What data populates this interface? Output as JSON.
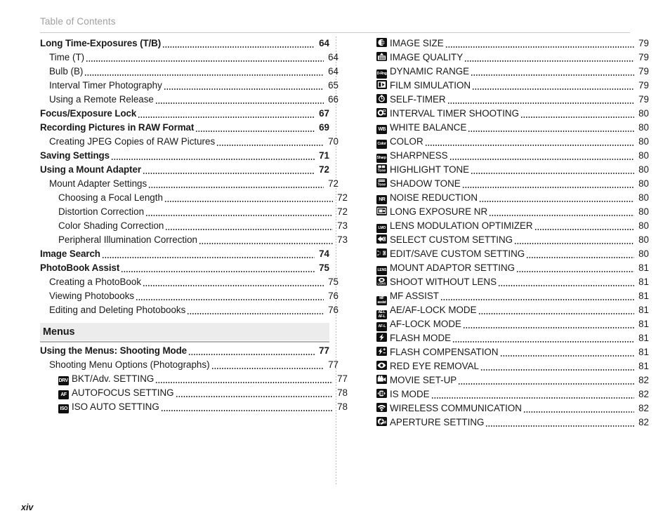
{
  "header": {
    "title": "Table of Contents"
  },
  "footer": {
    "page_label": "xiv"
  },
  "colors": {
    "band_bg": "#ececec",
    "header_text": "#a0a0a0",
    "rule": "#c9c9c9",
    "badge_bg": "#101010",
    "text": "#1a1a1a"
  },
  "left_column": {
    "entries": [
      {
        "level": 0,
        "title": "Long Time-Exposures (T/B)",
        "page": "64"
      },
      {
        "level": 1,
        "title": "Time (T)",
        "page": "64"
      },
      {
        "level": 1,
        "title": "Bulb (B)",
        "page": "64"
      },
      {
        "level": 1,
        "title": "Interval Timer Photography",
        "page": "65"
      },
      {
        "level": 1,
        "title": "Using a Remote Release",
        "page": "66"
      },
      {
        "level": 0,
        "title": "Focus/Exposure Lock",
        "page": "67"
      },
      {
        "level": 0,
        "title": "Recording Pictures in RAW Format",
        "page": "69"
      },
      {
        "level": 1,
        "title": "Creating JPEG Copies of RAW Pictures",
        "page": "70"
      },
      {
        "level": 0,
        "title": "Saving Settings",
        "page": "71"
      },
      {
        "level": 0,
        "title": "Using a Mount Adapter",
        "page": "72"
      },
      {
        "level": 1,
        "title": "Mount Adapter Settings",
        "page": "72"
      },
      {
        "level": 2,
        "title": "Choosing a Focal Length",
        "page": "72"
      },
      {
        "level": 2,
        "title": "Distortion Correction",
        "page": "72"
      },
      {
        "level": 2,
        "title": "Color Shading Correction",
        "page": "73"
      },
      {
        "level": 2,
        "title": "Peripheral Illumination Correction",
        "page": "73"
      },
      {
        "level": 0,
        "title": "Image Search",
        "page": "74"
      },
      {
        "level": 0,
        "title": "PhotoBook Assist",
        "page": "75"
      },
      {
        "level": 1,
        "title": "Creating a PhotoBook",
        "page": "75"
      },
      {
        "level": 1,
        "title": "Viewing Photobooks",
        "page": "76"
      },
      {
        "level": 1,
        "title": "Editing and Deleting Photobooks",
        "page": "76"
      },
      {
        "section": "Menus"
      },
      {
        "level": 0,
        "title": "Using the Menus: Shooting Mode",
        "page": "77"
      },
      {
        "level": 1,
        "title": "Shooting Menu Options (Photographs)",
        "page": "77"
      },
      {
        "level": 2,
        "icon": "drive-mode-icon",
        "icon_text": "DRV",
        "icon_style": "text",
        "title": "BKT/Adv. SETTING",
        "page": "77"
      },
      {
        "level": 2,
        "icon": "autofocus-icon",
        "icon_text": "AF",
        "icon_style": "text",
        "title": "AUTOFOCUS SETTING",
        "page": "78"
      },
      {
        "level": 2,
        "icon": "iso-icon",
        "icon_text": "ISO",
        "icon_style": "text",
        "title": "ISO AUTO SETTING",
        "page": "78"
      }
    ]
  },
  "right_column": {
    "entries": [
      {
        "level": 2,
        "icon": "image-size-icon",
        "icon_style": "shape",
        "shape": "image-size",
        "title": "IMAGE SIZE",
        "page": "79"
      },
      {
        "level": 2,
        "icon": "image-quality-icon",
        "icon_style": "shape",
        "shape": "image-quality",
        "title": "IMAGE QUALITY",
        "page": "79"
      },
      {
        "level": 2,
        "icon": "dynamic-range-icon",
        "icon_text": "D-Rng",
        "icon_style": "text-tiny",
        "title": "DYNAMIC RANGE",
        "page": "79"
      },
      {
        "level": 2,
        "icon": "film-simulation-icon",
        "icon_style": "shape",
        "shape": "film",
        "title": "FILM SIMULATION",
        "page": "79"
      },
      {
        "level": 2,
        "icon": "self-timer-icon",
        "icon_style": "shape",
        "shape": "timer",
        "title": "SELF-TIMER",
        "page": "79"
      },
      {
        "level": 2,
        "icon": "interval-timer-icon",
        "icon_style": "shape",
        "shape": "interval",
        "title": "INTERVAL TIMER SHOOTING",
        "page": "80"
      },
      {
        "level": 2,
        "icon": "white-balance-icon",
        "icon_text": "WB",
        "icon_style": "text",
        "title": "WHITE BALANCE",
        "page": "80"
      },
      {
        "level": 2,
        "icon": "color-icon",
        "icon_text": "Color",
        "icon_style": "text-tiny",
        "title": "COLOR",
        "page": "80"
      },
      {
        "level": 2,
        "icon": "sharpness-icon",
        "icon_text": "Sharp",
        "icon_style": "text-tiny",
        "title": "SHARPNESS",
        "page": "80"
      },
      {
        "level": 2,
        "icon": "highlight-tone-icon",
        "icon_text": "Tone",
        "icon_style": "tone-high",
        "title": "HIGHLIGHT TONE",
        "page": "80"
      },
      {
        "level": 2,
        "icon": "shadow-tone-icon",
        "icon_text": "Tone",
        "icon_style": "tone-low",
        "title": "SHADOW TONE",
        "page": "80"
      },
      {
        "level": 2,
        "icon": "noise-reduction-icon",
        "icon_text": "NR",
        "icon_style": "text",
        "title": "NOISE REDUCTION",
        "page": "80"
      },
      {
        "level": 2,
        "icon": "long-exposure-nr-icon",
        "icon_style": "shape",
        "shape": "longexp",
        "title": "LONG EXPOSURE NR",
        "page": "80"
      },
      {
        "level": 2,
        "icon": "lens-modulation-optimizer-icon",
        "icon_text": "LMO",
        "icon_style": "text-tiny",
        "title": "LENS MODULATION OPTIMIZER",
        "page": "80"
      },
      {
        "level": 2,
        "icon": "select-custom-setting-icon",
        "icon_style": "shape",
        "shape": "arrow-left-c",
        "title": "SELECT CUSTOM SETTING",
        "page": "80"
      },
      {
        "level": 2,
        "icon": "edit-save-custom-setting-icon",
        "icon_style": "shape",
        "shape": "arrow-right-c",
        "title": "EDIT/SAVE CUSTOM SETTING",
        "page": "80"
      },
      {
        "level": 2,
        "icon": "mount-adaptor-icon",
        "icon_text": "LENS",
        "icon_style": "text-tiny",
        "title": "MOUNT ADAPTOR SETTING",
        "page": "81"
      },
      {
        "level": 2,
        "icon": "shoot-without-lens-icon",
        "icon_style": "shape",
        "shape": "nolens",
        "title": "SHOOT WITHOUT LENS",
        "page": "81"
      },
      {
        "level": 2,
        "icon": "mf-assist-icon",
        "icon_text": "MF",
        "icon_style": "two-line",
        "icon_text2": "assist",
        "title": "MF ASSIST",
        "page": "81"
      },
      {
        "level": 2,
        "icon": "ae-af-lock-mode-icon",
        "icon_text": "AE-L",
        "icon_style": "two-line",
        "icon_text2": "AF-L",
        "title": "AE/AF-LOCK MODE",
        "page": "81"
      },
      {
        "level": 2,
        "icon": "af-lock-mode-icon",
        "icon_text": "AF-L",
        "icon_style": "text-tiny",
        "title": "AF-LOCK MODE",
        "page": "81"
      },
      {
        "level": 2,
        "icon": "flash-mode-icon",
        "icon_style": "shape",
        "shape": "flash",
        "title": "FLASH MODE",
        "page": "81"
      },
      {
        "level": 2,
        "icon": "flash-compensation-icon",
        "icon_style": "shape",
        "shape": "flash-pm",
        "title": "FLASH COMPENSATION",
        "page": "81"
      },
      {
        "level": 2,
        "icon": "red-eye-removal-icon",
        "icon_style": "shape",
        "shape": "eye",
        "title": "RED EYE REMOVAL",
        "page": "81"
      },
      {
        "level": 2,
        "icon": "movie-set-up-icon",
        "icon_style": "shape",
        "shape": "movie",
        "title": "MOVIE SET-UP",
        "page": "82"
      },
      {
        "level": 2,
        "icon": "is-mode-icon",
        "icon_style": "shape",
        "shape": "hand",
        "title": "IS MODE",
        "page": "82"
      },
      {
        "level": 2,
        "icon": "wireless-communication-icon",
        "icon_style": "shape",
        "shape": "wifi",
        "title": "WIRELESS COMMUNICATION",
        "page": "82"
      },
      {
        "level": 2,
        "icon": "aperture-setting-icon",
        "icon_style": "shape",
        "shape": "aperture",
        "title": "APERTURE SETTING",
        "page": "82"
      }
    ]
  }
}
